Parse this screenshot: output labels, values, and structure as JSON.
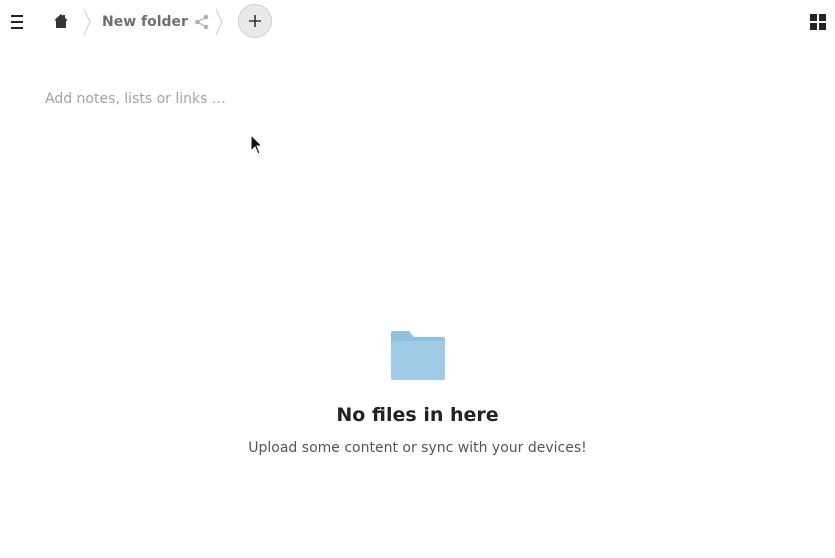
{
  "header": {
    "breadcrumb_current": "New folder",
    "add_button_symbol": "+"
  },
  "notes": {
    "placeholder": "Add notes, lists or links …"
  },
  "empty_state": {
    "title": "No files in here",
    "subtitle": "Upload some content or sync with your devices!"
  },
  "icons": {
    "menu": "hamburger-menu-icon",
    "home": "home-icon",
    "share": "share-icon",
    "add": "plus-icon",
    "view": "grid-view-icon",
    "folder": "folder-icon"
  },
  "colors": {
    "folder": "#9fcbe6",
    "folder_tab": "#8fc0df",
    "add_button_bg": "#e9e9e9",
    "placeholder": "#a3a3a3"
  }
}
